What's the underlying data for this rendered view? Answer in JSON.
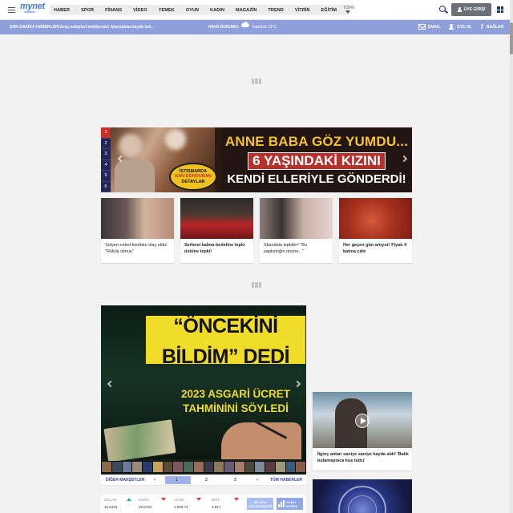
{
  "header": {
    "logo": "mynet",
    "nav": [
      "HABER",
      "SPOR",
      "FİNANS",
      "VİDEO",
      "YEMEK",
      "OYUN",
      "KADIN",
      "MAGAZİN",
      "TREND",
      "VİTRİN",
      "EĞİTİM"
    ],
    "more_label": "TÜMÜ",
    "login_label": "ÜYE GİRİŞİ",
    "icons": [
      "menu-icon",
      "search-icon",
      "user-icon",
      "apps-grid-icon"
    ]
  },
  "breaking": {
    "label": "SON DAKİKA HABERLERİ:",
    "text": "Araç sahipleri bekliyordu! Akaryakıta büyük ind...",
    "weather_label": "HAVA DURUMU:",
    "weather_text": "İstanbul 13°C",
    "email_label": "EMAIL",
    "signup_label": "ÜYE OL",
    "connect_label": "BAĞLAN",
    "fb_glyph": "f"
  },
  "headline_slider": {
    "numbers": [
      "1",
      "2",
      "3",
      "4",
      "5",
      "6"
    ],
    "active": 1,
    "line1": "ANNE BABA GÖZ YUMDU...",
    "line2": "6 YAŞINDAKİ KIZINI",
    "line3": "KENDİ ELLERİYLE GÖNDERDİ!",
    "badge": [
      "İSTİSMARDA",
      "KAN DONDURAN",
      "DETAYLAR"
    ]
  },
  "news_cards": [
    {
      "text": "Sütyen-ceket kombini olay oldu! \"Rüküş olmuş\"",
      "bold": false
    },
    {
      "text": "Serbest kalma bedeline tepki üstüne tepki!",
      "bold": true
    },
    {
      "text": "Skandala tepkiler! \"Bu sapkınlığın önüne...\"",
      "bold": false
    },
    {
      "text": "Her geçen gün artıyor! Fiyatı 4 katına çıktı",
      "bold": true
    }
  ],
  "manset": {
    "line1": "“ÖNCEKİNİ",
    "line2": "BİLDİM” DEDİ",
    "line3": "2023 ASGARİ ÜCRET",
    "line4": "TAHMİNİNİ SÖYLEDİ",
    "other_label": "DİĞER MANŞETLER",
    "pages": [
      "1",
      "2",
      "3"
    ],
    "all_news_label": "TÜM HABERLER",
    "prev_glyph": "‹",
    "next_glyph": "›"
  },
  "market": [
    {
      "name": "DOLAR",
      "value": "18,6423",
      "trend": "up"
    },
    {
      "name": "EURO",
      "value": "19,5752",
      "trend": "down"
    },
    {
      "name": "ALTIN",
      "value": "1.068,74",
      "trend": "down"
    },
    {
      "name": "BIST",
      "value": "4.817",
      "trend": "down"
    }
  ],
  "market_buttons": {
    "most_searched": "EN ÇOK YÜKSELENLER",
    "live": "CANLI BORSA"
  },
  "video": {
    "text": "İlginç anları saniye saniye kayda aldı! 'Balık bulamayınca kuş tuttu'"
  }
}
